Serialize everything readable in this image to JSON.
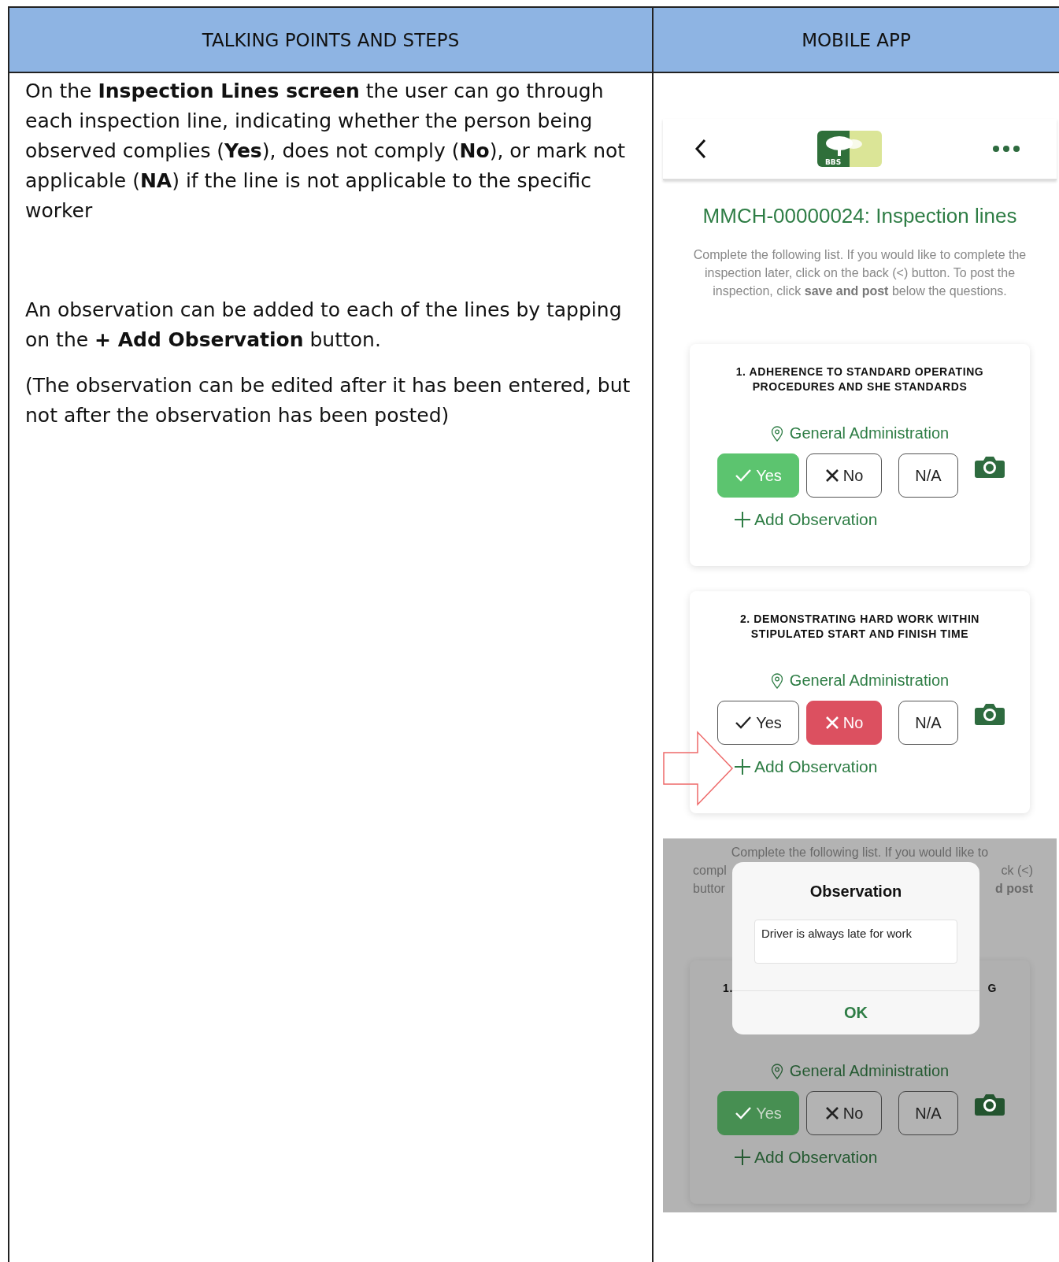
{
  "table": {
    "columns": [
      {
        "label": "TALKING POINTS AND STEPS"
      },
      {
        "label": "MOBILE APP"
      }
    ],
    "talking_points": [
      "On the **Inspection Lines screen** the user can go through each inspection line, indicating whether the person being observed complies (**Yes**), does not comply (**No**), or mark not applicable (**NA**) if the line is not applicable to the specific worker",
      "An observation can be added to each of the lines by tapping on the **+ Add Observation** button.",
      "(The observation can be edited after it has been entered, but not after the observation has been posted)"
    ],
    "mobile_app": {
      "logo_text": "BBS",
      "title": "MMCH-00000024: Inspection lines",
      "description": "Complete the following list. If you would like to complete the inspection later, click on the back (<) button. To post the inspection, click **save and post** below the questions.",
      "lines": [
        {
          "question": "1. ADHERENCE TO STANDARD OPERATING PROCEDURES AND SHE STANDARDS",
          "location": "General Administration",
          "options": [
            {
              "label": "Yes",
              "kind": "yes",
              "selected": true
            },
            {
              "label": "No",
              "kind": "no",
              "selected": false
            },
            {
              "label": "N/A",
              "kind": "na",
              "selected": false
            }
          ],
          "add_observation": "Add Observation",
          "highlighted": false
        },
        {
          "question": "2. DEMONSTRATING HARD WORK WITHIN STIPULATED START AND FINISH TIME",
          "location": "General Administration",
          "options": [
            {
              "label": "Yes",
              "kind": "yes",
              "selected": false
            },
            {
              "label": "No",
              "kind": "no",
              "selected": true
            },
            {
              "label": "N/A",
              "kind": "na",
              "selected": false
            }
          ],
          "add_observation": "Add Observation",
          "highlighted": true
        }
      ],
      "dialog_screen": {
        "first_line": "Complete the following list. If you would like to",
        "fragment_rows": [
          {
            "left": "compl",
            "right": "ck (<)",
            "right_bold": false
          },
          {
            "left": "buttor",
            "right": "d post",
            "right_bold": true
          }
        ],
        "card": {
          "left_fragment": "1.",
          "right_fragment": "G",
          "location": "General Administration",
          "options": [
            {
              "label": "Yes",
              "kind": "yes",
              "selected": true
            },
            {
              "label": "No",
              "kind": "no",
              "selected": false
            },
            {
              "label": "N/A",
              "kind": "na",
              "selected": false
            }
          ],
          "add_observation": "Add Observation"
        },
        "dialog": {
          "title": "Observation",
          "value": "Driver is always late for work",
          "button": "OK"
        }
      }
    }
  }
}
